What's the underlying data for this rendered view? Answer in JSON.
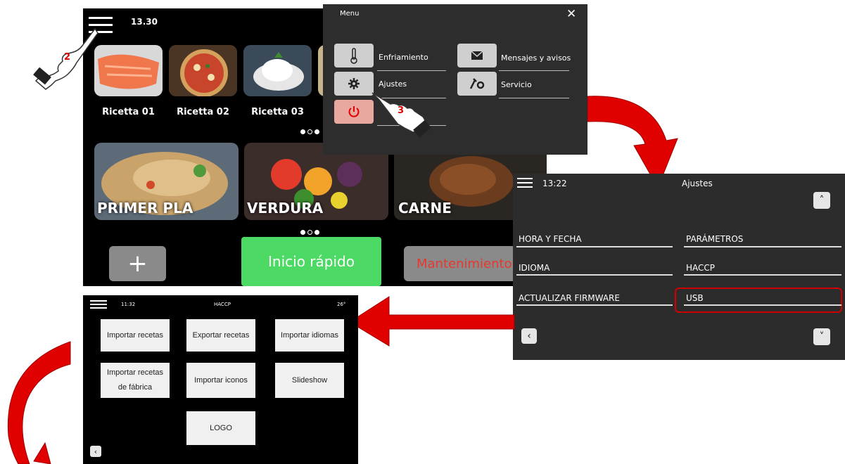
{
  "main_screen": {
    "time": "13.30",
    "recipes": [
      "Ricetta 01",
      "Ricetta 02",
      "Ricetta 03"
    ],
    "categories": [
      "PRIMER PLA",
      "VERDURA",
      "CARNE"
    ],
    "quick_start": "Inicio rápido",
    "maintenance": "Mantenimiento",
    "add_symbol": "+"
  },
  "menu_panel": {
    "title": "Menu",
    "close": "✕",
    "items": [
      "Enfriamiento",
      "Mensajes y avisos",
      "Ajustes",
      "Servicio"
    ]
  },
  "ajustes_screen": {
    "time": "13:22",
    "title": "Ajustes",
    "items": [
      "HORA Y FECHA",
      "PARÁMETROS",
      "IDIOMA",
      "HACCP",
      "ACTUALIZAR FIRMWARE",
      "USB"
    ],
    "up": "˄",
    "down": "˅",
    "back": "‹"
  },
  "haccp_screen": {
    "time": "11:32",
    "title": "HACCP",
    "temp": "26°",
    "buttons": [
      "Importar recetas",
      "Exportar recetas",
      "Importar idiomas",
      "Importar recetas de fábrica",
      "Importar iconos",
      "Slideshow",
      "LOGO"
    ],
    "back": "‹"
  },
  "step_labels": {
    "step2": "2",
    "step3": "3"
  },
  "colors": {
    "accent_green": "#4cd964",
    "maintenance_red": "#e8382d",
    "arrow_red": "#e00000",
    "highlight_red": "#d00000"
  }
}
